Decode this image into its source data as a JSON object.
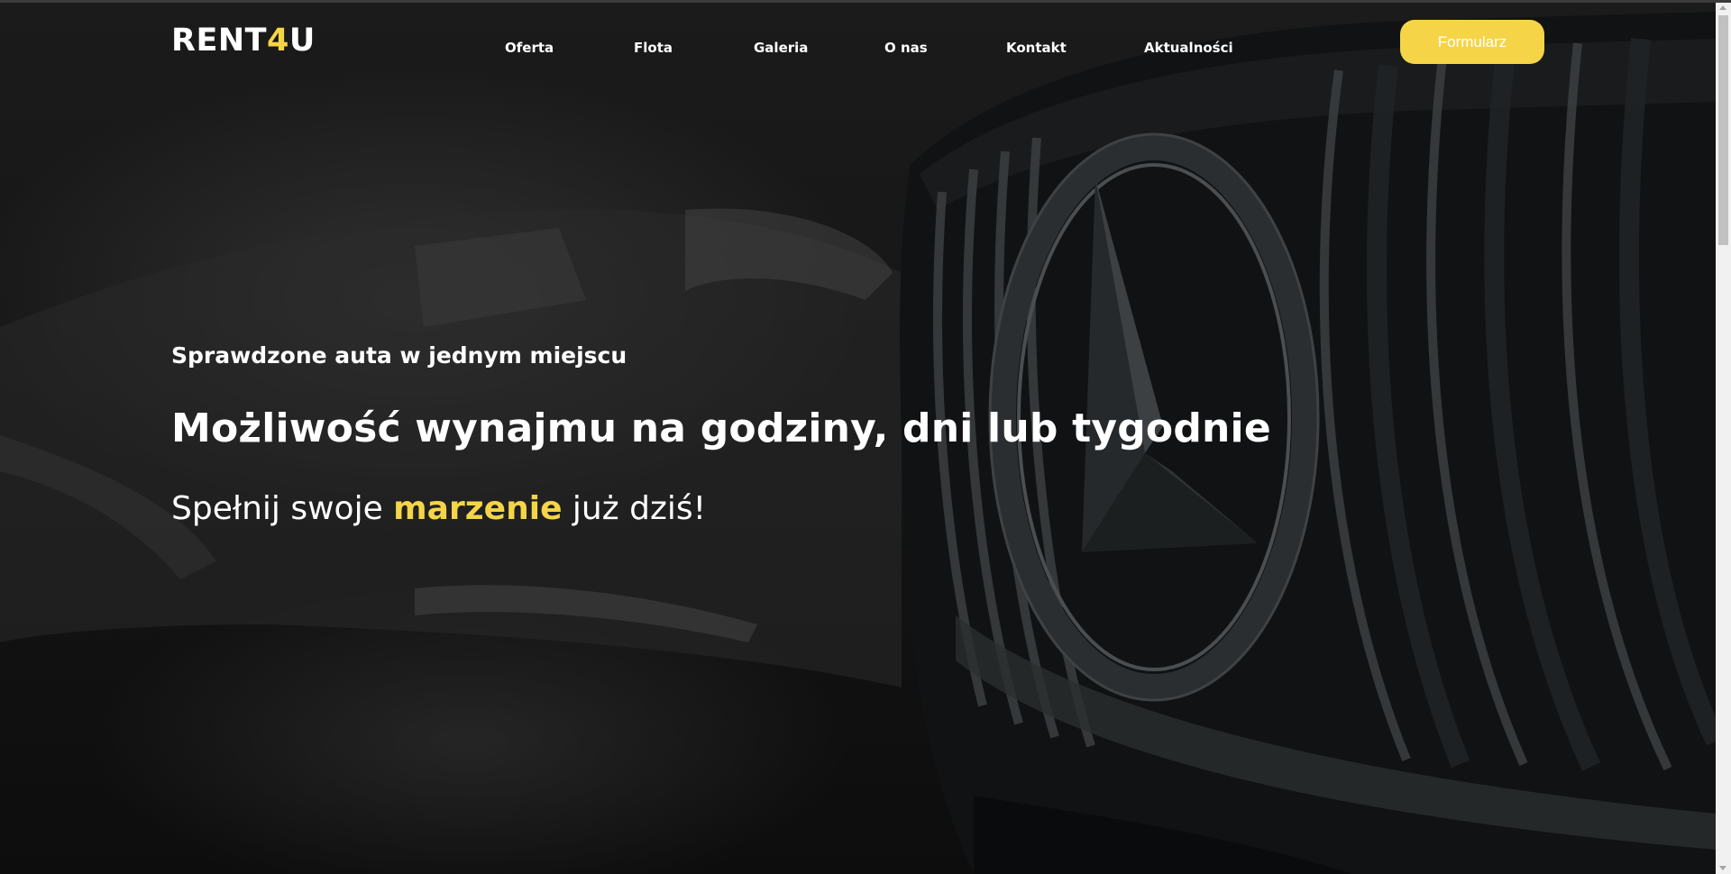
{
  "brand": {
    "logo_main": "RENT",
    "logo_accent": "4",
    "logo_end": "U"
  },
  "nav": {
    "items": [
      {
        "label": "Oferta"
      },
      {
        "label": "Flota"
      },
      {
        "label": "Galeria"
      },
      {
        "label": "O nas"
      },
      {
        "label": "Kontakt"
      },
      {
        "label": "Aktualności"
      }
    ],
    "cta_label": "Formularz"
  },
  "hero": {
    "subtitle": "Sprawdzone auta w jednym miejscu",
    "headline": "Możliwość wynajmu na godziny, dni lub tygodnie",
    "tagline_before": "Spełnij swoje ",
    "tagline_highlight": "marzenie",
    "tagline_after": " już dziś!"
  },
  "colors": {
    "accent": "#f5d547",
    "text": "#ffffff",
    "background": "#151515"
  }
}
